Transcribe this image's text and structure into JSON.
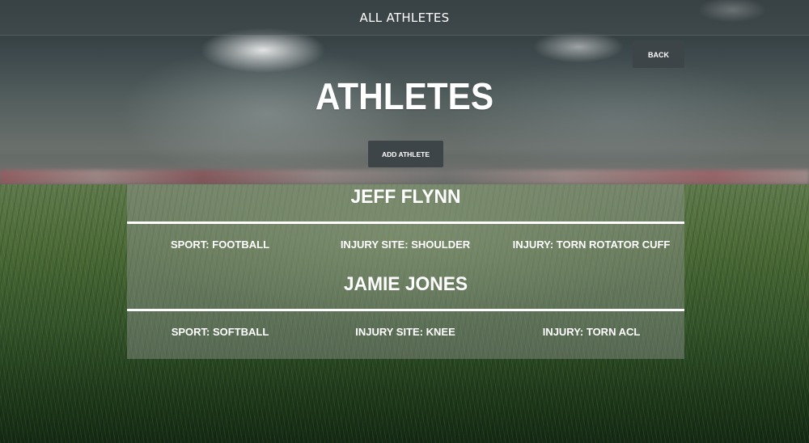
{
  "header": {
    "title": "ALL ATHLETES"
  },
  "actions": {
    "back_label": "BACK",
    "add_label": "ADD ATHLETE"
  },
  "page": {
    "title": "ATHLETES"
  },
  "athletes": [
    {
      "name": "JEFF FLYNN",
      "sport": "SPORT: FOOTBALL",
      "injury_site": "INJURY SITE: SHOULDER",
      "injury": "INJURY: TORN ROTATOR CUFF"
    },
    {
      "name": "JAMIE JONES",
      "sport": "SPORT: SOFTBALL",
      "injury_site": "INJURY SITE: KNEE",
      "injury": "INJURY: TORN ACL"
    }
  ],
  "colors": {
    "button_bg": "#3e4549",
    "text": "#ffffff",
    "divider": "#ffffff"
  }
}
